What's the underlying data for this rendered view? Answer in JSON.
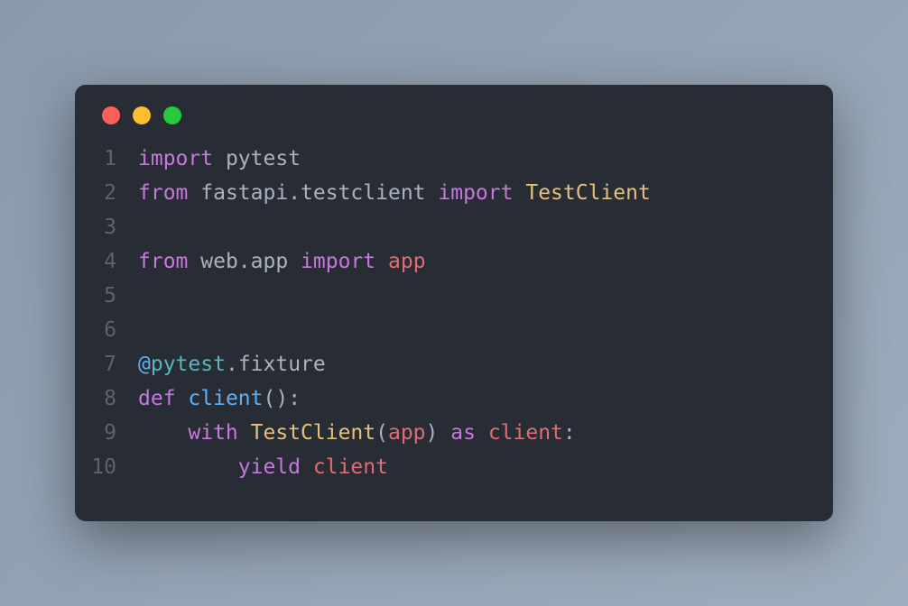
{
  "window": {
    "traffic_lights": {
      "red": "#ff5f56",
      "yellow": "#ffbd2e",
      "green": "#27c93f"
    }
  },
  "code": {
    "lines": [
      {
        "num": "1",
        "tokens": [
          {
            "t": "import",
            "c": "kw-import"
          },
          {
            "t": " ",
            "c": "default"
          },
          {
            "t": "pytest",
            "c": "default"
          }
        ]
      },
      {
        "num": "2",
        "tokens": [
          {
            "t": "from",
            "c": "kw-from"
          },
          {
            "t": " ",
            "c": "default"
          },
          {
            "t": "fastapi",
            "c": "default"
          },
          {
            "t": ".",
            "c": "punct"
          },
          {
            "t": "testclient",
            "c": "default"
          },
          {
            "t": " ",
            "c": "default"
          },
          {
            "t": "import",
            "c": "kw-import"
          },
          {
            "t": " ",
            "c": "default"
          },
          {
            "t": "TestClient",
            "c": "class-name"
          }
        ]
      },
      {
        "num": "3",
        "tokens": []
      },
      {
        "num": "4",
        "tokens": [
          {
            "t": "from",
            "c": "kw-from"
          },
          {
            "t": " ",
            "c": "default"
          },
          {
            "t": "web",
            "c": "default"
          },
          {
            "t": ".",
            "c": "punct"
          },
          {
            "t": "app",
            "c": "default"
          },
          {
            "t": " ",
            "c": "default"
          },
          {
            "t": "import",
            "c": "kw-import"
          },
          {
            "t": " ",
            "c": "default"
          },
          {
            "t": "app",
            "c": "var"
          }
        ]
      },
      {
        "num": "5",
        "tokens": []
      },
      {
        "num": "6",
        "tokens": []
      },
      {
        "num": "7",
        "tokens": [
          {
            "t": "@",
            "c": "decorator-at"
          },
          {
            "t": "pytest",
            "c": "decorator-name"
          },
          {
            "t": ".",
            "c": "punct"
          },
          {
            "t": "fixture",
            "c": "default"
          }
        ]
      },
      {
        "num": "8",
        "tokens": [
          {
            "t": "def",
            "c": "kw-def"
          },
          {
            "t": " ",
            "c": "default"
          },
          {
            "t": "client",
            "c": "func-name"
          },
          {
            "t": "()",
            "c": "paren"
          },
          {
            "t": ":",
            "c": "punct"
          }
        ]
      },
      {
        "num": "9",
        "tokens": [
          {
            "t": "    ",
            "c": "default"
          },
          {
            "t": "with",
            "c": "kw-with"
          },
          {
            "t": " ",
            "c": "default"
          },
          {
            "t": "TestClient",
            "c": "class-name"
          },
          {
            "t": "(",
            "c": "paren"
          },
          {
            "t": "app",
            "c": "var"
          },
          {
            "t": ")",
            "c": "paren"
          },
          {
            "t": " ",
            "c": "default"
          },
          {
            "t": "as",
            "c": "kw-as"
          },
          {
            "t": " ",
            "c": "default"
          },
          {
            "t": "client",
            "c": "var"
          },
          {
            "t": ":",
            "c": "punct"
          }
        ]
      },
      {
        "num": "10",
        "tokens": [
          {
            "t": "        ",
            "c": "default"
          },
          {
            "t": "yield",
            "c": "kw-yield"
          },
          {
            "t": " ",
            "c": "default"
          },
          {
            "t": "client",
            "c": "var"
          }
        ]
      }
    ]
  }
}
